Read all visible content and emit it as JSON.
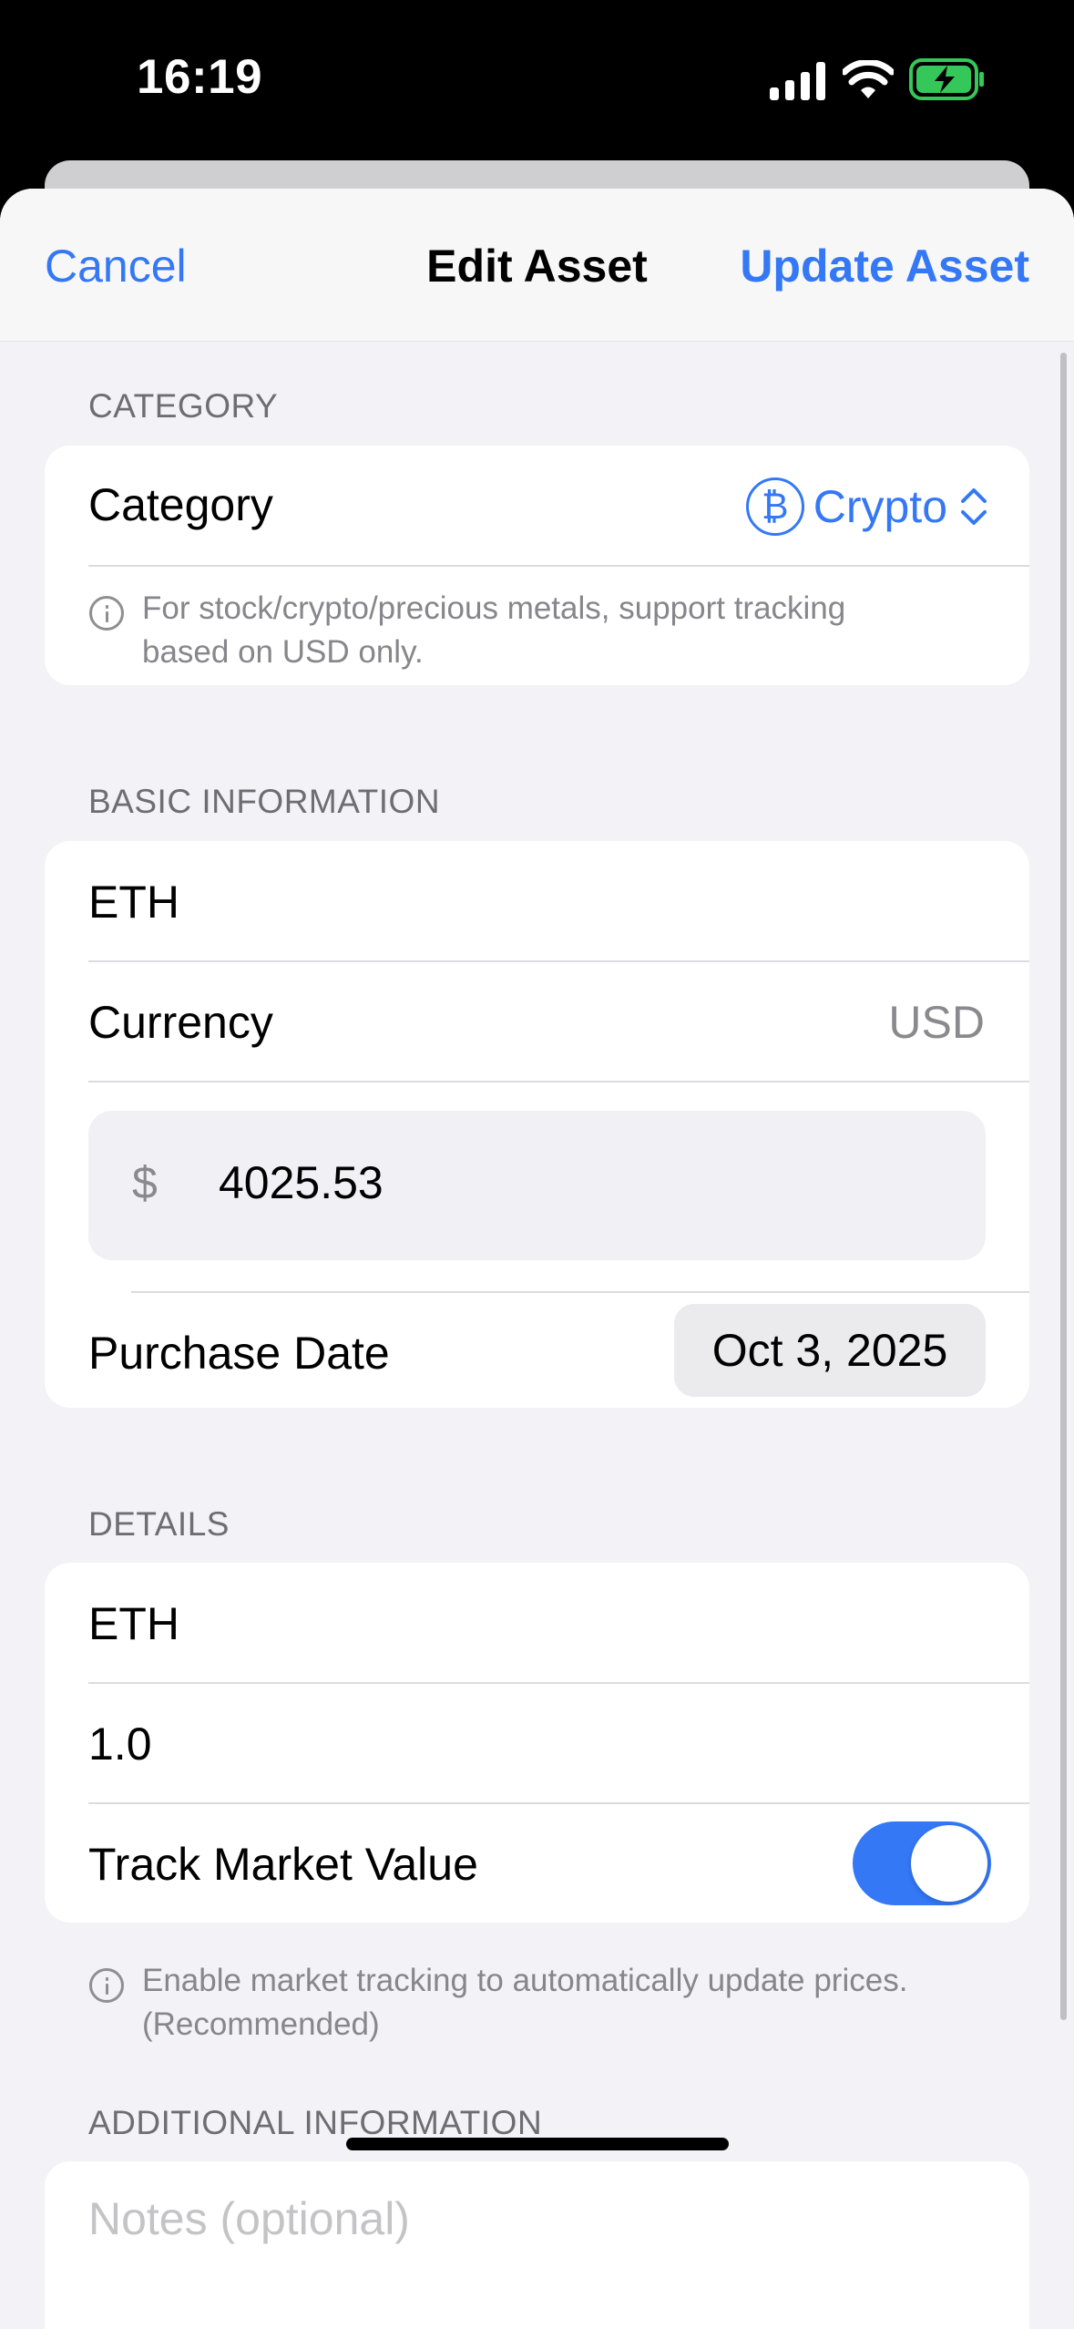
{
  "status_bar": {
    "time": "16:19",
    "icons": [
      "cellular-signal-icon",
      "wifi-icon",
      "battery-charging-icon"
    ],
    "battery_color": "#34c759"
  },
  "nav": {
    "cancel_label": "Cancel",
    "title": "Edit Asset",
    "update_label": "Update Asset"
  },
  "accent_color": "#3478f6",
  "category_section": {
    "header": "CATEGORY",
    "row_label": "Category",
    "selected_value": "Crypto",
    "selected_icon": "bitcoin-icon",
    "btc_glyph": "₿",
    "info_text_line1": "For stock/crypto/precious metals, support tracking",
    "info_text_line2": "based on USD only."
  },
  "basic_section": {
    "header": "BASIC INFORMATION",
    "name_value": "ETH",
    "currency_label": "Currency",
    "currency_value": "USD",
    "price_symbol": "$",
    "price_value": "4025.53",
    "purchase_date_label": "Purchase Date",
    "purchase_date_value": "Oct 3, 2025"
  },
  "details_section": {
    "header": "DETAILS",
    "symbol_value": "ETH",
    "quantity_value": "1.0",
    "track_label": "Track Market Value",
    "track_enabled": true,
    "info_text_line1": "Enable market tracking to automatically update prices.",
    "info_text_line2": "(Recommended)"
  },
  "additional_section": {
    "header": "ADDITIONAL INFORMATION",
    "notes_placeholder": "Notes (optional)"
  }
}
